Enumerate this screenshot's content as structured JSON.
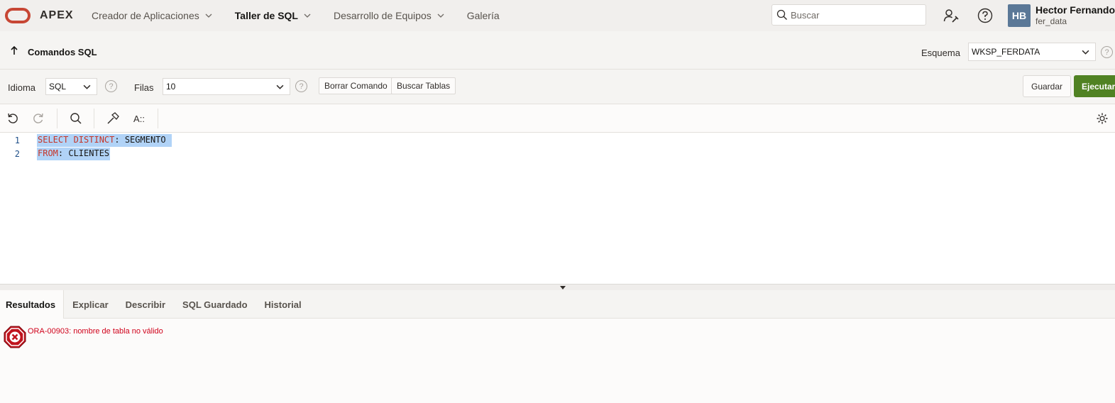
{
  "header": {
    "brand": "APEX",
    "nav": [
      {
        "label": "Creador de Aplicaciones",
        "active": false,
        "dropdown": true
      },
      {
        "label": "Taller de SQL",
        "active": true,
        "dropdown": true
      },
      {
        "label": "Desarrollo de Equipos",
        "active": false,
        "dropdown": true
      },
      {
        "label": "Galería",
        "active": false,
        "dropdown": false
      }
    ],
    "search_placeholder": "Buscar",
    "user": {
      "initials": "HB",
      "name": "Hector Fernando .",
      "workspace": "fer_data"
    }
  },
  "titlebar": {
    "title": "Comandos SQL",
    "schema_label": "Esquema",
    "schema_value": "WKSP_FERDATA"
  },
  "options": {
    "language_label": "Idioma",
    "language_value": "SQL",
    "rows_label": "Filas",
    "rows_value": "10",
    "clear_label": "Borrar Comando",
    "find_tables_label": "Buscar Tablas",
    "save_label": "Guardar",
    "run_label": "Ejecutar"
  },
  "editor": {
    "lines": [
      {
        "number": "1",
        "keyword": "SELECT DISTINCT",
        "rest": ": SEGMENTO "
      },
      {
        "number": "2",
        "keyword": "FROM",
        "rest": ": CLIENTES"
      }
    ]
  },
  "results": {
    "tabs": [
      "Resultados",
      "Explicar",
      "Describir",
      "SQL Guardado",
      "Historial"
    ],
    "active_tab": "Resultados",
    "error_message": "ORA-00903: nombre de tabla no válido"
  },
  "colors": {
    "run_button": "#508223",
    "error": "#d0021b",
    "brand_logo": "#c74634",
    "selection": "#b1d3f7"
  }
}
